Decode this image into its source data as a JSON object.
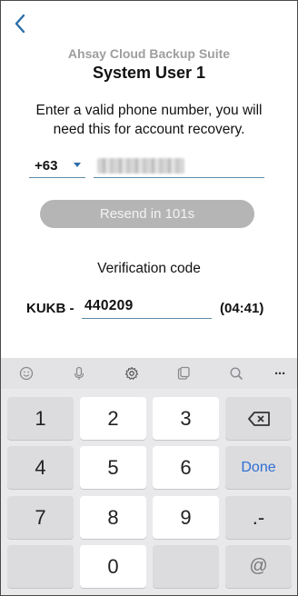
{
  "header": {
    "suite_name": "Ahsay Cloud Backup Suite",
    "user_name": "System User 1"
  },
  "instructions": "Enter a valid phone number, you will need this for account recovery.",
  "phone": {
    "country_code": "+63",
    "number_obscured": true
  },
  "resend_button": "Resend in 101s",
  "verification": {
    "label": "Verification code",
    "prefix": "KUKB -",
    "code": "440209",
    "timer": "(04:41)"
  },
  "keyboard": {
    "toolbar_icons": [
      "emoji-icon",
      "microphone-icon",
      "settings-icon",
      "clipboard-icon",
      "search-icon",
      "more-icon"
    ],
    "more_label": "···",
    "keys": {
      "k1": "1",
      "k2": "2",
      "k3": "3",
      "k4": "4",
      "k5": "5",
      "k6": "6",
      "k7": "7",
      "k8": "8",
      "k9": "9",
      "k0": "0",
      "done": "Done",
      "dot_dash": ".-",
      "at": "@"
    }
  },
  "colors": {
    "accent": "#2b6ea8",
    "underline": "#5b8aa6",
    "button_disabled": "#b5b5b5",
    "done_blue": "#2f6fd1"
  }
}
